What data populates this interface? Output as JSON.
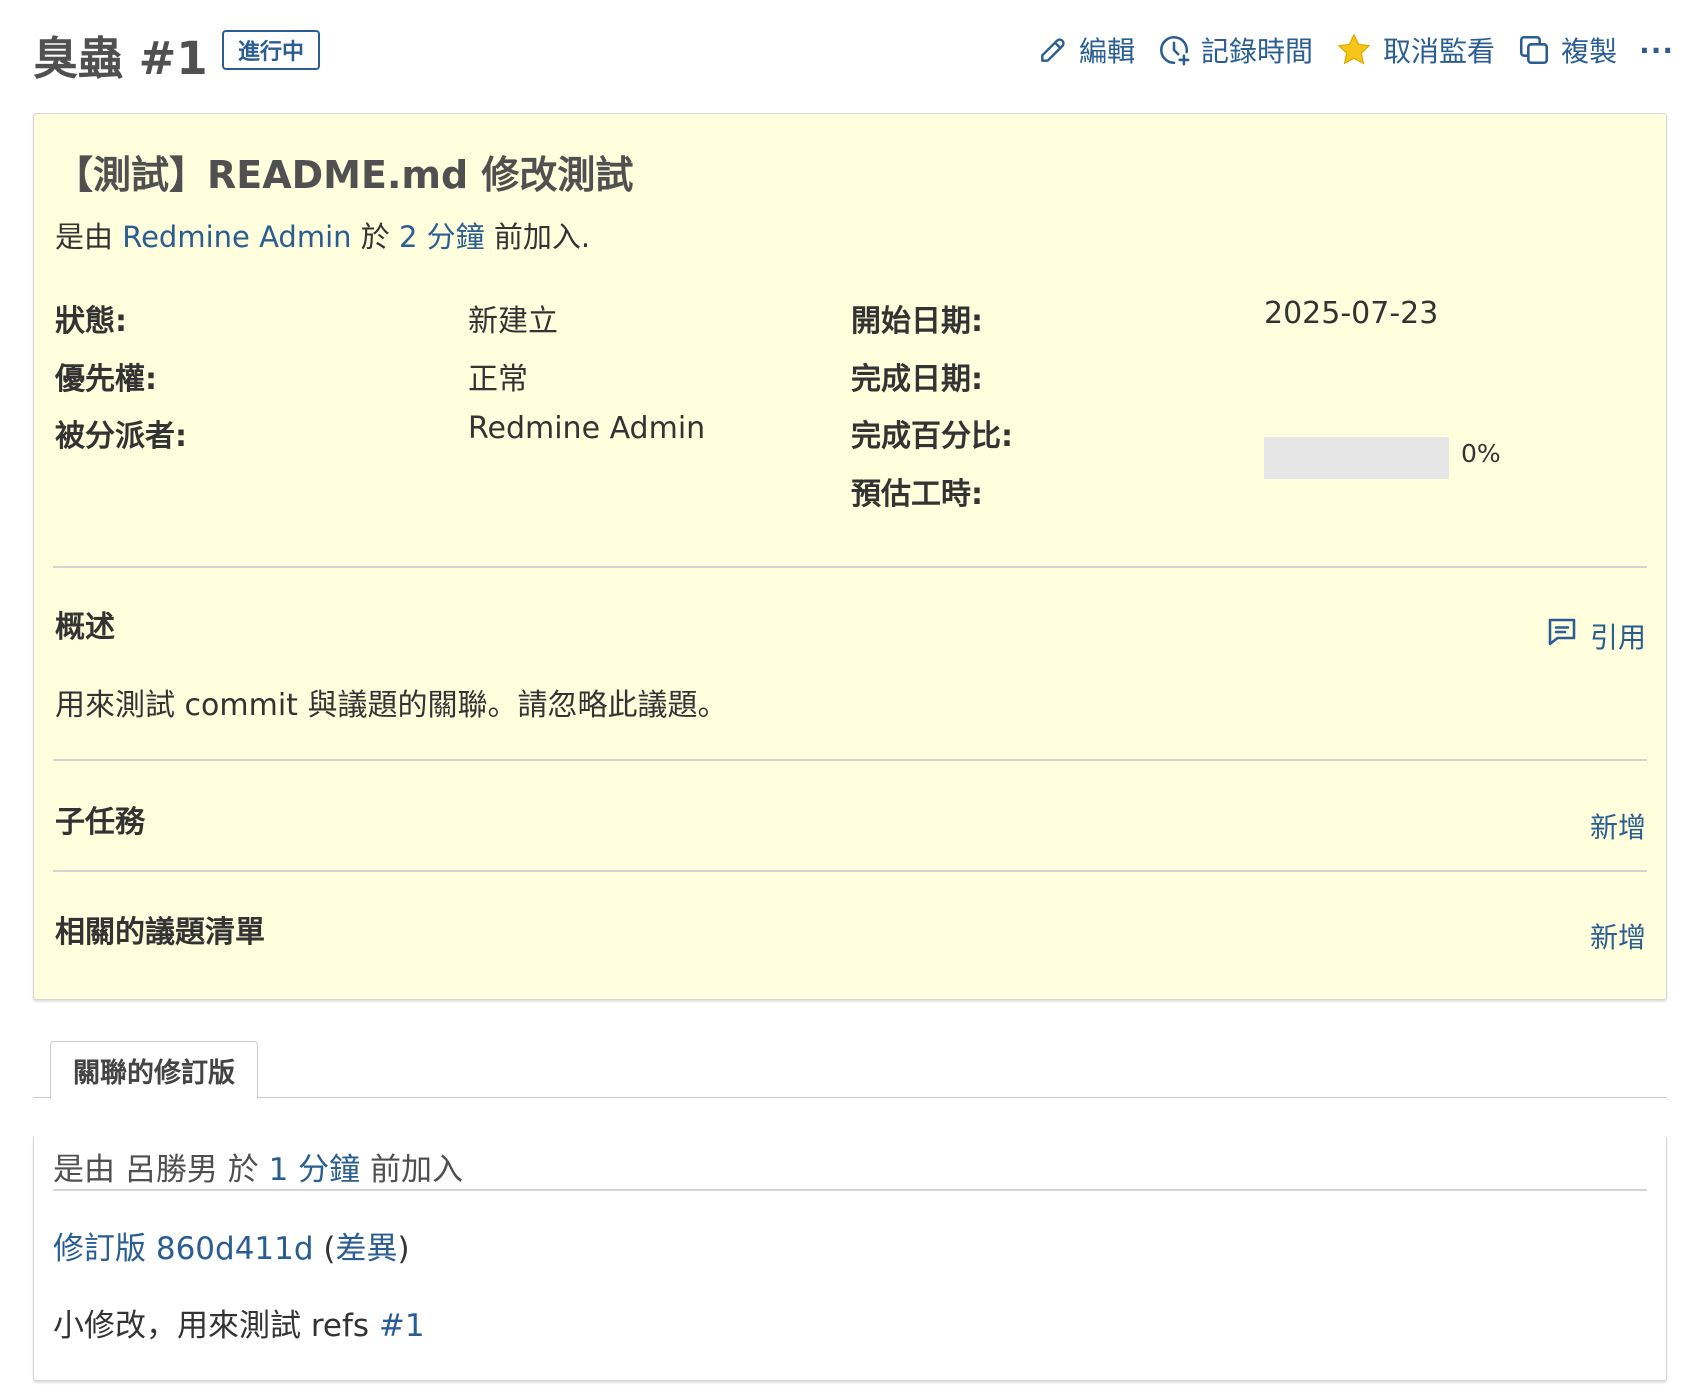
{
  "header": {
    "title": "臭蟲 #1",
    "status_badge": "進行中",
    "toolbar": {
      "edit": "編輯",
      "log_time": "記錄時間",
      "unwatch": "取消監看",
      "copy": "複製",
      "more": "···"
    }
  },
  "issue": {
    "subject": "【測試】README.md 修改測試",
    "author_prefix": "是由",
    "author": "Redmine Admin",
    "author_mid": "於",
    "age": "2 分鐘",
    "author_suffix": "前加入.",
    "attributes": {
      "status_label": "狀態:",
      "status_value": "新建立",
      "priority_label": "優先權:",
      "priority_value": "正常",
      "assignee_label": "被分派者:",
      "assignee_value": "Redmine Admin",
      "start_date_label": "開始日期:",
      "start_date_value": "2025-07-23",
      "due_date_label": "完成日期:",
      "due_date_value": "",
      "done_ratio_label": "完成百分比:",
      "done_ratio": 0,
      "done_ratio_text": "0%",
      "estimated_label": "預估工時:",
      "estimated_value": ""
    },
    "description": {
      "title": "概述",
      "quote": "引用",
      "text": "用來測試 commit 與議題的關聯。請忽略此議題。"
    },
    "subtasks": {
      "title": "子任務",
      "add": "新增"
    },
    "relations": {
      "title": "相關的議題清單",
      "add": "新增"
    }
  },
  "tabs": [
    {
      "label": "關聯的修訂版",
      "active": true
    }
  ],
  "changeset": {
    "prefix": "是由",
    "author": "呂勝男",
    "mid": "於",
    "age": "1 分鐘",
    "suffix": "前加入",
    "revision_link": "修訂版 860d411d",
    "open_paren": "(",
    "diff_link": "差異",
    "close_paren": ")",
    "comment_text": "小修改，用來測試 refs",
    "comment_ref": "#1"
  },
  "colors": {
    "link": "#2a5e93",
    "issue_background": "#ffffdd",
    "star": "#f5c518",
    "progress_track": "#e6e6e6"
  },
  "icons": [
    "pencil-icon",
    "clock-plus-icon",
    "star-icon",
    "copy-icon",
    "ellipsis-icon",
    "comment-quote-icon"
  ]
}
